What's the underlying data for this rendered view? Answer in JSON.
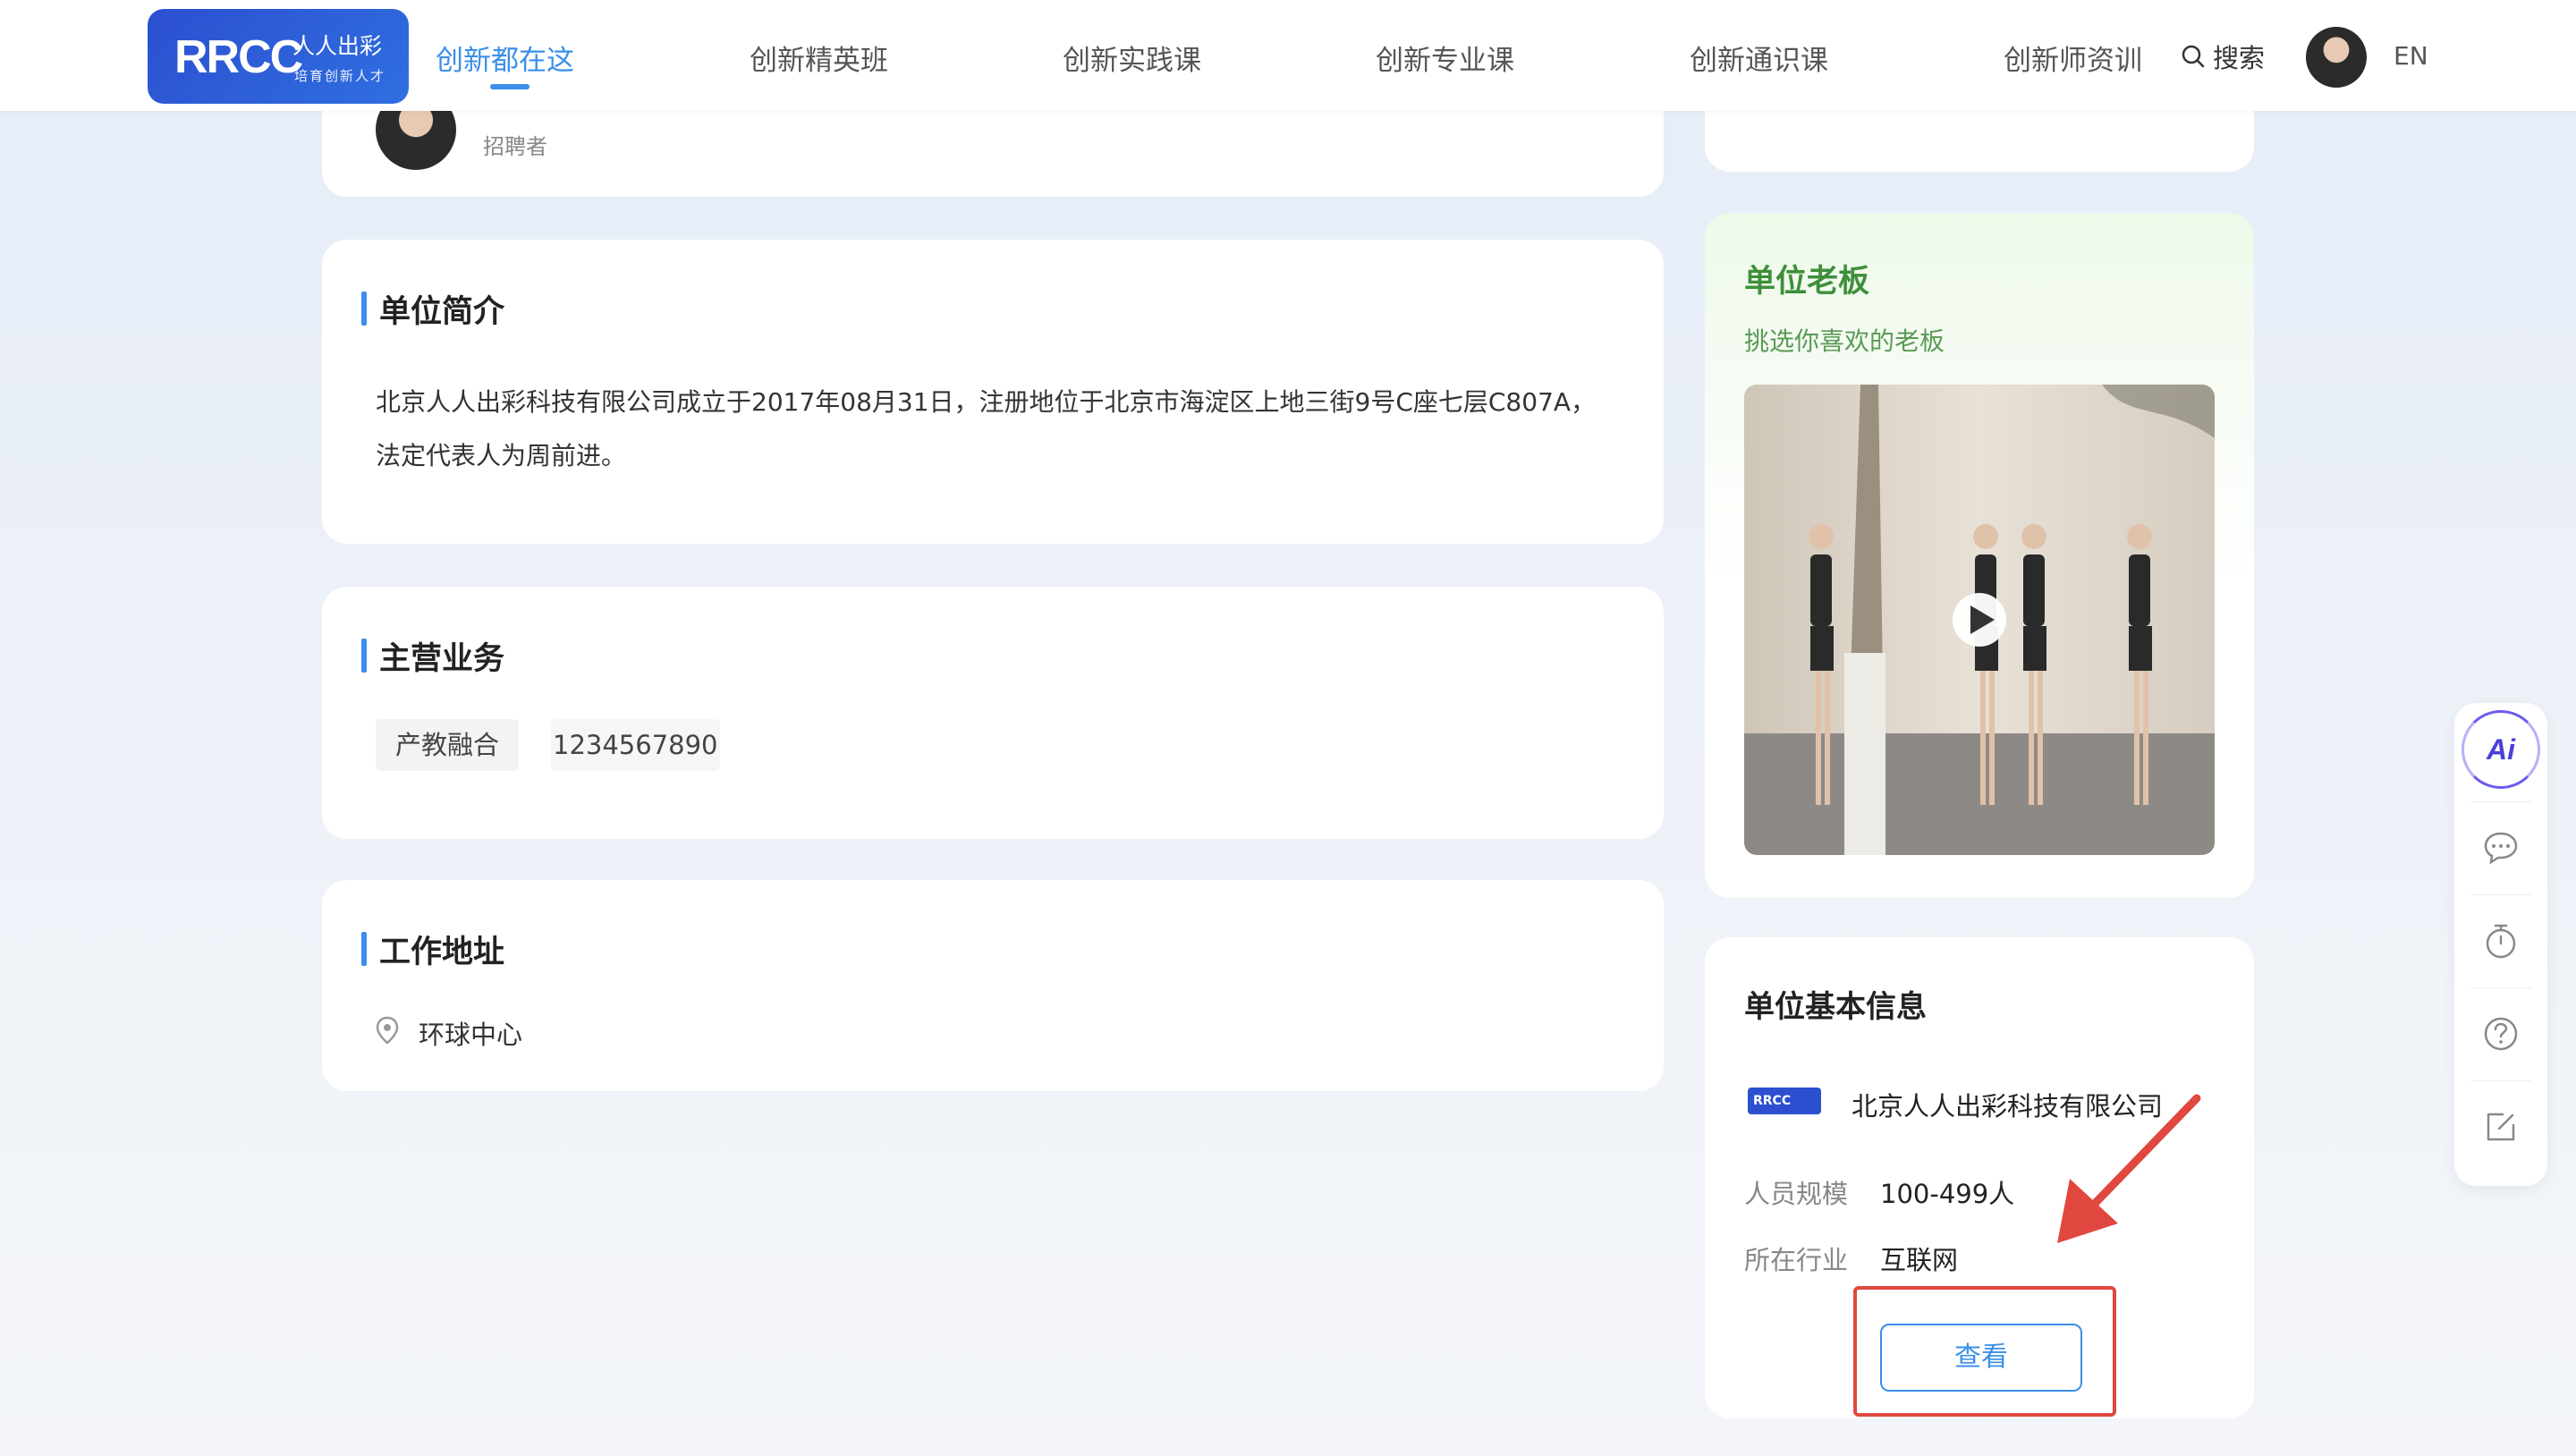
{
  "header": {
    "logo": {
      "brand": "RRCC",
      "name_cn": "人人出彩",
      "slogan": "培育创新人才"
    },
    "nav": [
      {
        "label": "创新都在这",
        "active": true
      },
      {
        "label": "创新精英班",
        "active": false
      },
      {
        "label": "创新实践课",
        "active": false
      },
      {
        "label": "创新专业课",
        "active": false
      },
      {
        "label": "创新通识课",
        "active": false
      },
      {
        "label": "创新师资训",
        "active": false
      }
    ],
    "search_label": "搜索",
    "lang_label": "EN"
  },
  "recruiter": {
    "role": "招聘者"
  },
  "intro": {
    "title": "单位简介",
    "text": "北京人人出彩科技有限公司成立于2017年08月31日，注册地位于北京市海淀区上地三街9号C座七层C807A，法定代表人为周前进。"
  },
  "business": {
    "title": "主营业务",
    "tags": [
      "产教融合",
      "1234567890"
    ]
  },
  "address": {
    "title": "工作地址",
    "location": "环球中心"
  },
  "boss": {
    "title": "单位老板",
    "subtitle": "挑选你喜欢的老板"
  },
  "company_info": {
    "title": "单位基本信息",
    "company_name": "北京人人出彩科技有限公司",
    "logo_text": "RRCC",
    "scale_label": "人员规模",
    "scale_value": "100-499人",
    "industry_label": "所在行业",
    "industry_value": "互联网",
    "view_button": "查看"
  },
  "sidebar": {
    "ai_label": "Ai"
  },
  "colors": {
    "accent": "#3a8fe8",
    "green_title": "#3f8f3a",
    "annotation_red": "#e0483f"
  }
}
